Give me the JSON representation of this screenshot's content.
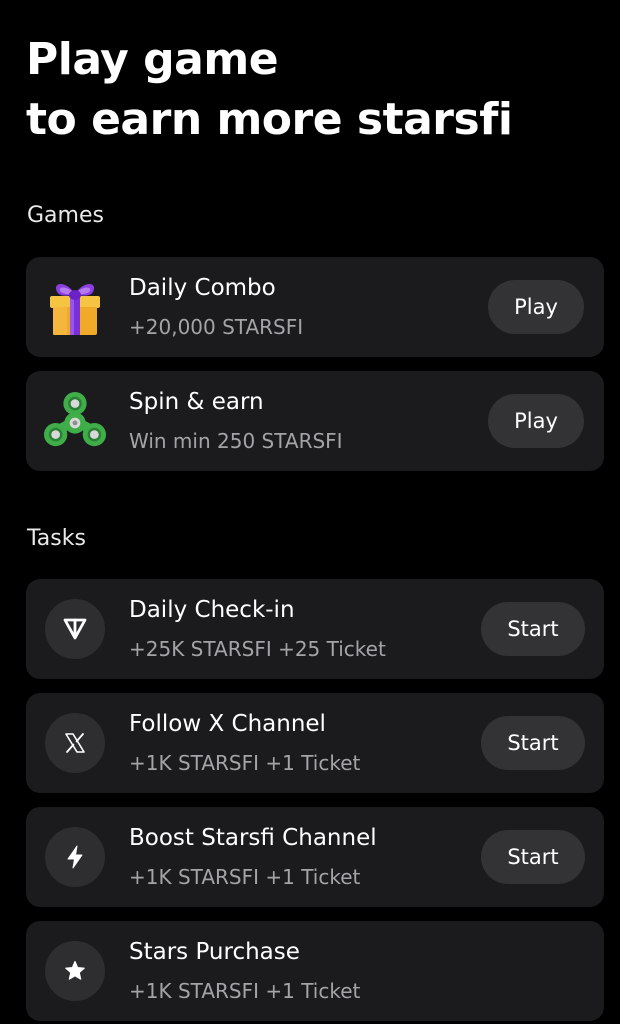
{
  "header": {
    "line1": "Play game",
    "line2": "to earn more starsfi"
  },
  "games": {
    "label": "Games",
    "items": [
      {
        "title": "Daily Combo",
        "subtitle": "+20,000 STARSFI",
        "action": "Play",
        "icon": "gift-icon"
      },
      {
        "title": "Spin & earn",
        "subtitle": "Win min 250 STARSFI",
        "action": "Play",
        "icon": "fidget-spinner-icon"
      }
    ]
  },
  "tasks": {
    "label": "Tasks",
    "items": [
      {
        "title": "Daily Check-in",
        "subtitle": "+25K STARSFI +25 Ticket",
        "action": "Start",
        "icon": "ton-logo-icon"
      },
      {
        "title": "Follow X Channel",
        "subtitle": "+1K STARSFI +1 Ticket",
        "action": "Start",
        "icon": "x-logo-icon"
      },
      {
        "title": "Boost Starsfi Channel",
        "subtitle": "+1K STARSFI +1 Ticket",
        "action": "Start",
        "icon": "lightning-icon"
      },
      {
        "title": "Stars Purchase",
        "subtitle": "+1K STARSFI +1 Ticket",
        "icon": "star-icon"
      }
    ]
  },
  "colors": {
    "background": "#000000",
    "card": "#1b1b1d",
    "button": "#333336",
    "subtitle": "#a4a4a8",
    "gift_box": "#f4b42a",
    "gift_ribbon": "#7b2fd6",
    "spinner": "#3fae49"
  }
}
